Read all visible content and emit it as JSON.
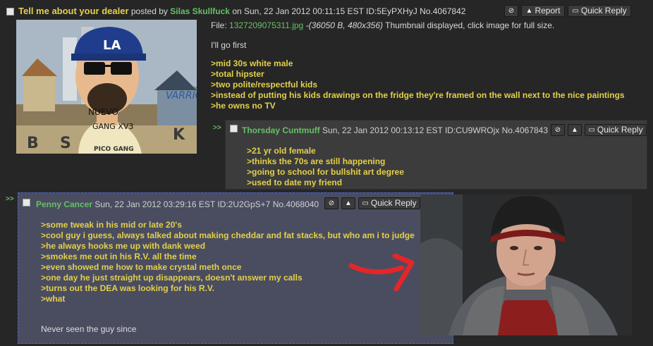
{
  "op": {
    "subject": "Tell me about your dealer",
    "posted_by_text": "posted by",
    "name": "Silas Skullfuck",
    "datetime": "on Sun, 22 Jan 2012 00:11:15 EST",
    "id": "ID:5EyPXHyJ",
    "number": "No.4067842",
    "report_label": "Report",
    "quick_reply_label": "Quick Reply",
    "file_label": "File:",
    "file_name": "1327209075311.jpg",
    "file_info": "-(36050 B, 480x356)",
    "file_note": "Thumbnail displayed, click image for full size.",
    "intro": "I'll go first",
    "lines": [
      ">mid 30s white male",
      ">total hipster",
      ">two polite/respectful kids",
      ">instead of putting his kids drawings on the fridge they're framed on the wall next to the nice paintings",
      ">he owns no TV"
    ],
    "image_text": {
      "cap_letters": "LA",
      "neck": "NUEVO",
      "chest": "GANG XV3",
      "shirt": "PICO GANG",
      "sign": "VARRIO",
      "wall_b": "B",
      "wall_s": "S",
      "wall_k": "K"
    }
  },
  "reply1": {
    "arrows": ">>",
    "name": "Thorsday Cuntmuff",
    "datetime": "Sun, 22 Jan 2012 00:13:12 EST",
    "id": "ID:CU9WROjx",
    "number": "No.4067843",
    "quick_reply_label": "Quick Reply",
    "lines": [
      ">21 yr old female",
      ">thinks the 70s are still happening",
      ">going to school for bullshit art degree",
      ">used to date my friend"
    ]
  },
  "reply2": {
    "arrows": ">>",
    "name": "Penny Cancer",
    "datetime": "Sun, 22 Jan 2012 03:29:16 EST",
    "id": "ID:2U2GpS+7",
    "number": "No.4068040",
    "quick_reply_label": "Quick Reply",
    "lines": [
      ">some tweak in his mid or late 20's",
      ">cool guy i guess, always talked about making cheddar and fat stacks, but who am i to judge",
      ">he always hooks me up with dank weed",
      ">smokes me out in his R.V. all the time",
      ">even showed me how to make crystal meth once",
      ">one day he just straight up disappears, doesn't answer my calls",
      ">turns out the DEA was looking for his R.V.",
      ">what"
    ],
    "closing": "Never seen the guy since"
  },
  "colors": {
    "background": "#262626",
    "reply_bg": "#3c3c3c",
    "highlight_bg": "#4a4d60",
    "greentext": "#e3d04a",
    "name": "#66c066",
    "arrow_red": "#e3262a"
  },
  "icons": {
    "hide": "no-entry-icon",
    "report": "warning-icon",
    "quick_reply": "speech-bubble-icon"
  }
}
